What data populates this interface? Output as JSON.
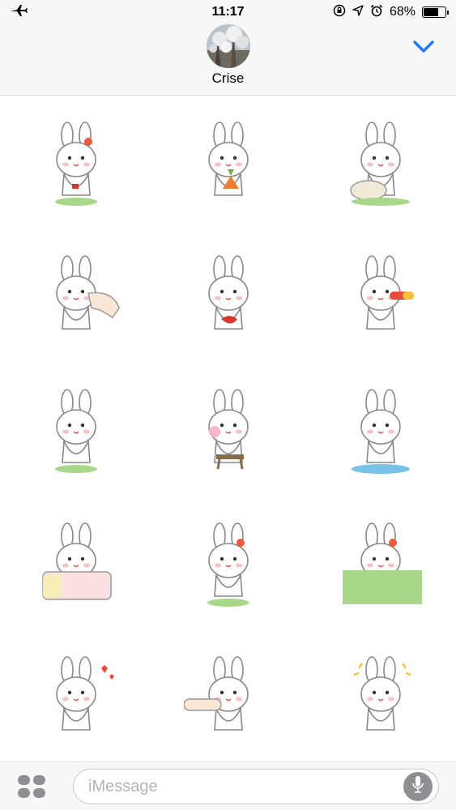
{
  "status_bar": {
    "time": "11:17",
    "battery_percent": "68%",
    "battery_level": 0.68,
    "icons": [
      "airplane-icon",
      "rotation-lock-icon",
      "location-icon",
      "alarm-icon",
      "battery-icon"
    ]
  },
  "header": {
    "contact_name": "Crise",
    "collapse_icon": "chevron-down-icon",
    "accent_color": "#1a7cf5"
  },
  "stickers": [
    {
      "name": "bunny-waving"
    },
    {
      "name": "bunny-eating-carrot"
    },
    {
      "name": "bunny-massaging-friend"
    },
    {
      "name": "bunny-poked-by-finger"
    },
    {
      "name": "bunny-holding-ribbon"
    },
    {
      "name": "bunny-with-pill"
    },
    {
      "name": "bunny-dancing"
    },
    {
      "name": "bunny-lollipop-on-stool"
    },
    {
      "name": "bunny-crying-puddle"
    },
    {
      "name": "bunny-in-bed"
    },
    {
      "name": "bunny-walking-flower"
    },
    {
      "name": "bunny-running-tears"
    },
    {
      "name": "bunny-kiss-hearts"
    },
    {
      "name": "bunny-cheek-poked"
    },
    {
      "name": "bunny-angry"
    }
  ],
  "composer": {
    "placeholder": "iMessage",
    "apps_icon": "app-drawer-icon",
    "mic_icon": "microphone-icon"
  }
}
